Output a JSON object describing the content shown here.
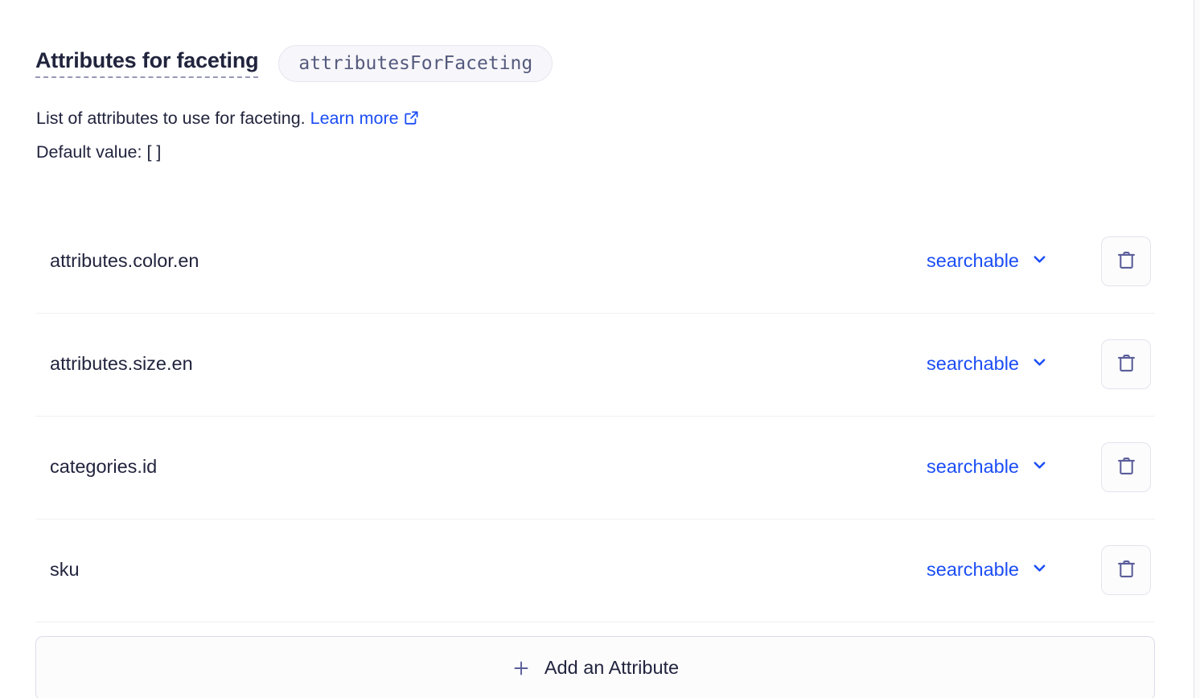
{
  "setting": {
    "title": "Attributes for faceting",
    "api_key": "attributesForFaceting",
    "description_text": "List of attributes to use for faceting.",
    "learn_more_label": "Learn more",
    "default_value_label": "Default value:",
    "default_value": "[ ]"
  },
  "attributes": [
    {
      "name": "attributes.color.en",
      "mode": "searchable"
    },
    {
      "name": "attributes.size.en",
      "mode": "searchable"
    },
    {
      "name": "categories.id",
      "mode": "searchable"
    },
    {
      "name": "sku",
      "mode": "searchable"
    }
  ],
  "add_button": {
    "label": "Add an Attribute",
    "icon": "plus-icon"
  },
  "icons": {
    "external_link": "external-link-icon",
    "chevron_down": "chevron-down-icon",
    "trash": "trash-icon"
  },
  "colors": {
    "link_blue": "#1b4df5",
    "text_navy": "#21243d",
    "pill_bg": "#f7f7fb",
    "pill_text": "#555a7d",
    "icon_slate": "#5a5d99",
    "divider": "#f0f0f5"
  }
}
